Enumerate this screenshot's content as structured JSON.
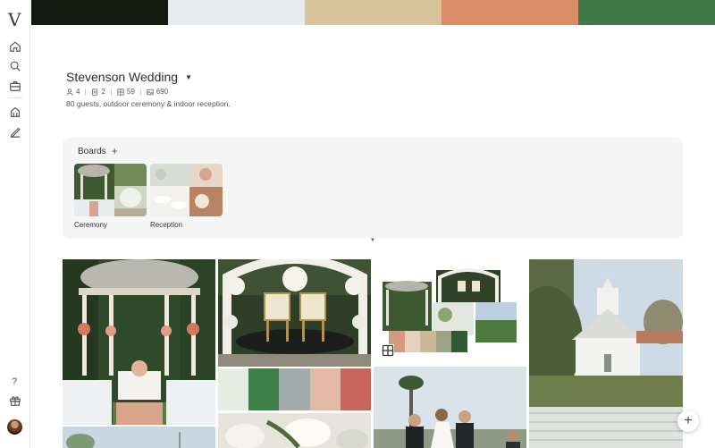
{
  "app": {
    "logo_text": "V",
    "rail_icons": [
      "home-icon",
      "search-icon",
      "briefcase-icon",
      "building-icon",
      "pen-icon",
      "help-icon",
      "gift-icon"
    ],
    "help_label": "?"
  },
  "palette": [
    "#141a12",
    "#e8ebee",
    "#d9c49a",
    "#dc8c67",
    "#3f7a47"
  ],
  "project": {
    "title": "Stevenson Wedding",
    "stats": [
      {
        "icon": "people-icon",
        "value": "4"
      },
      {
        "icon": "document-icon",
        "value": "2"
      },
      {
        "icon": "grid-icon",
        "value": "59"
      },
      {
        "icon": "image-icon",
        "value": "690"
      }
    ],
    "description": "80 guests, outdoor ceremony & indoor reception."
  },
  "boards": {
    "heading": "Boards",
    "add_label": "+",
    "items": [
      {
        "label": "Ceremony"
      },
      {
        "label": "Reception"
      }
    ]
  },
  "mood_swatches": [
    "#e6ebe4",
    "#3f8048",
    "#a3acaa",
    "#e2baa6",
    "#c7655a"
  ],
  "mini_swatches": [
    "#d49a7e",
    "#e3d2bd",
    "#c9b99a",
    "#9aa485",
    "#2f5a33"
  ],
  "fab_label": "+"
}
